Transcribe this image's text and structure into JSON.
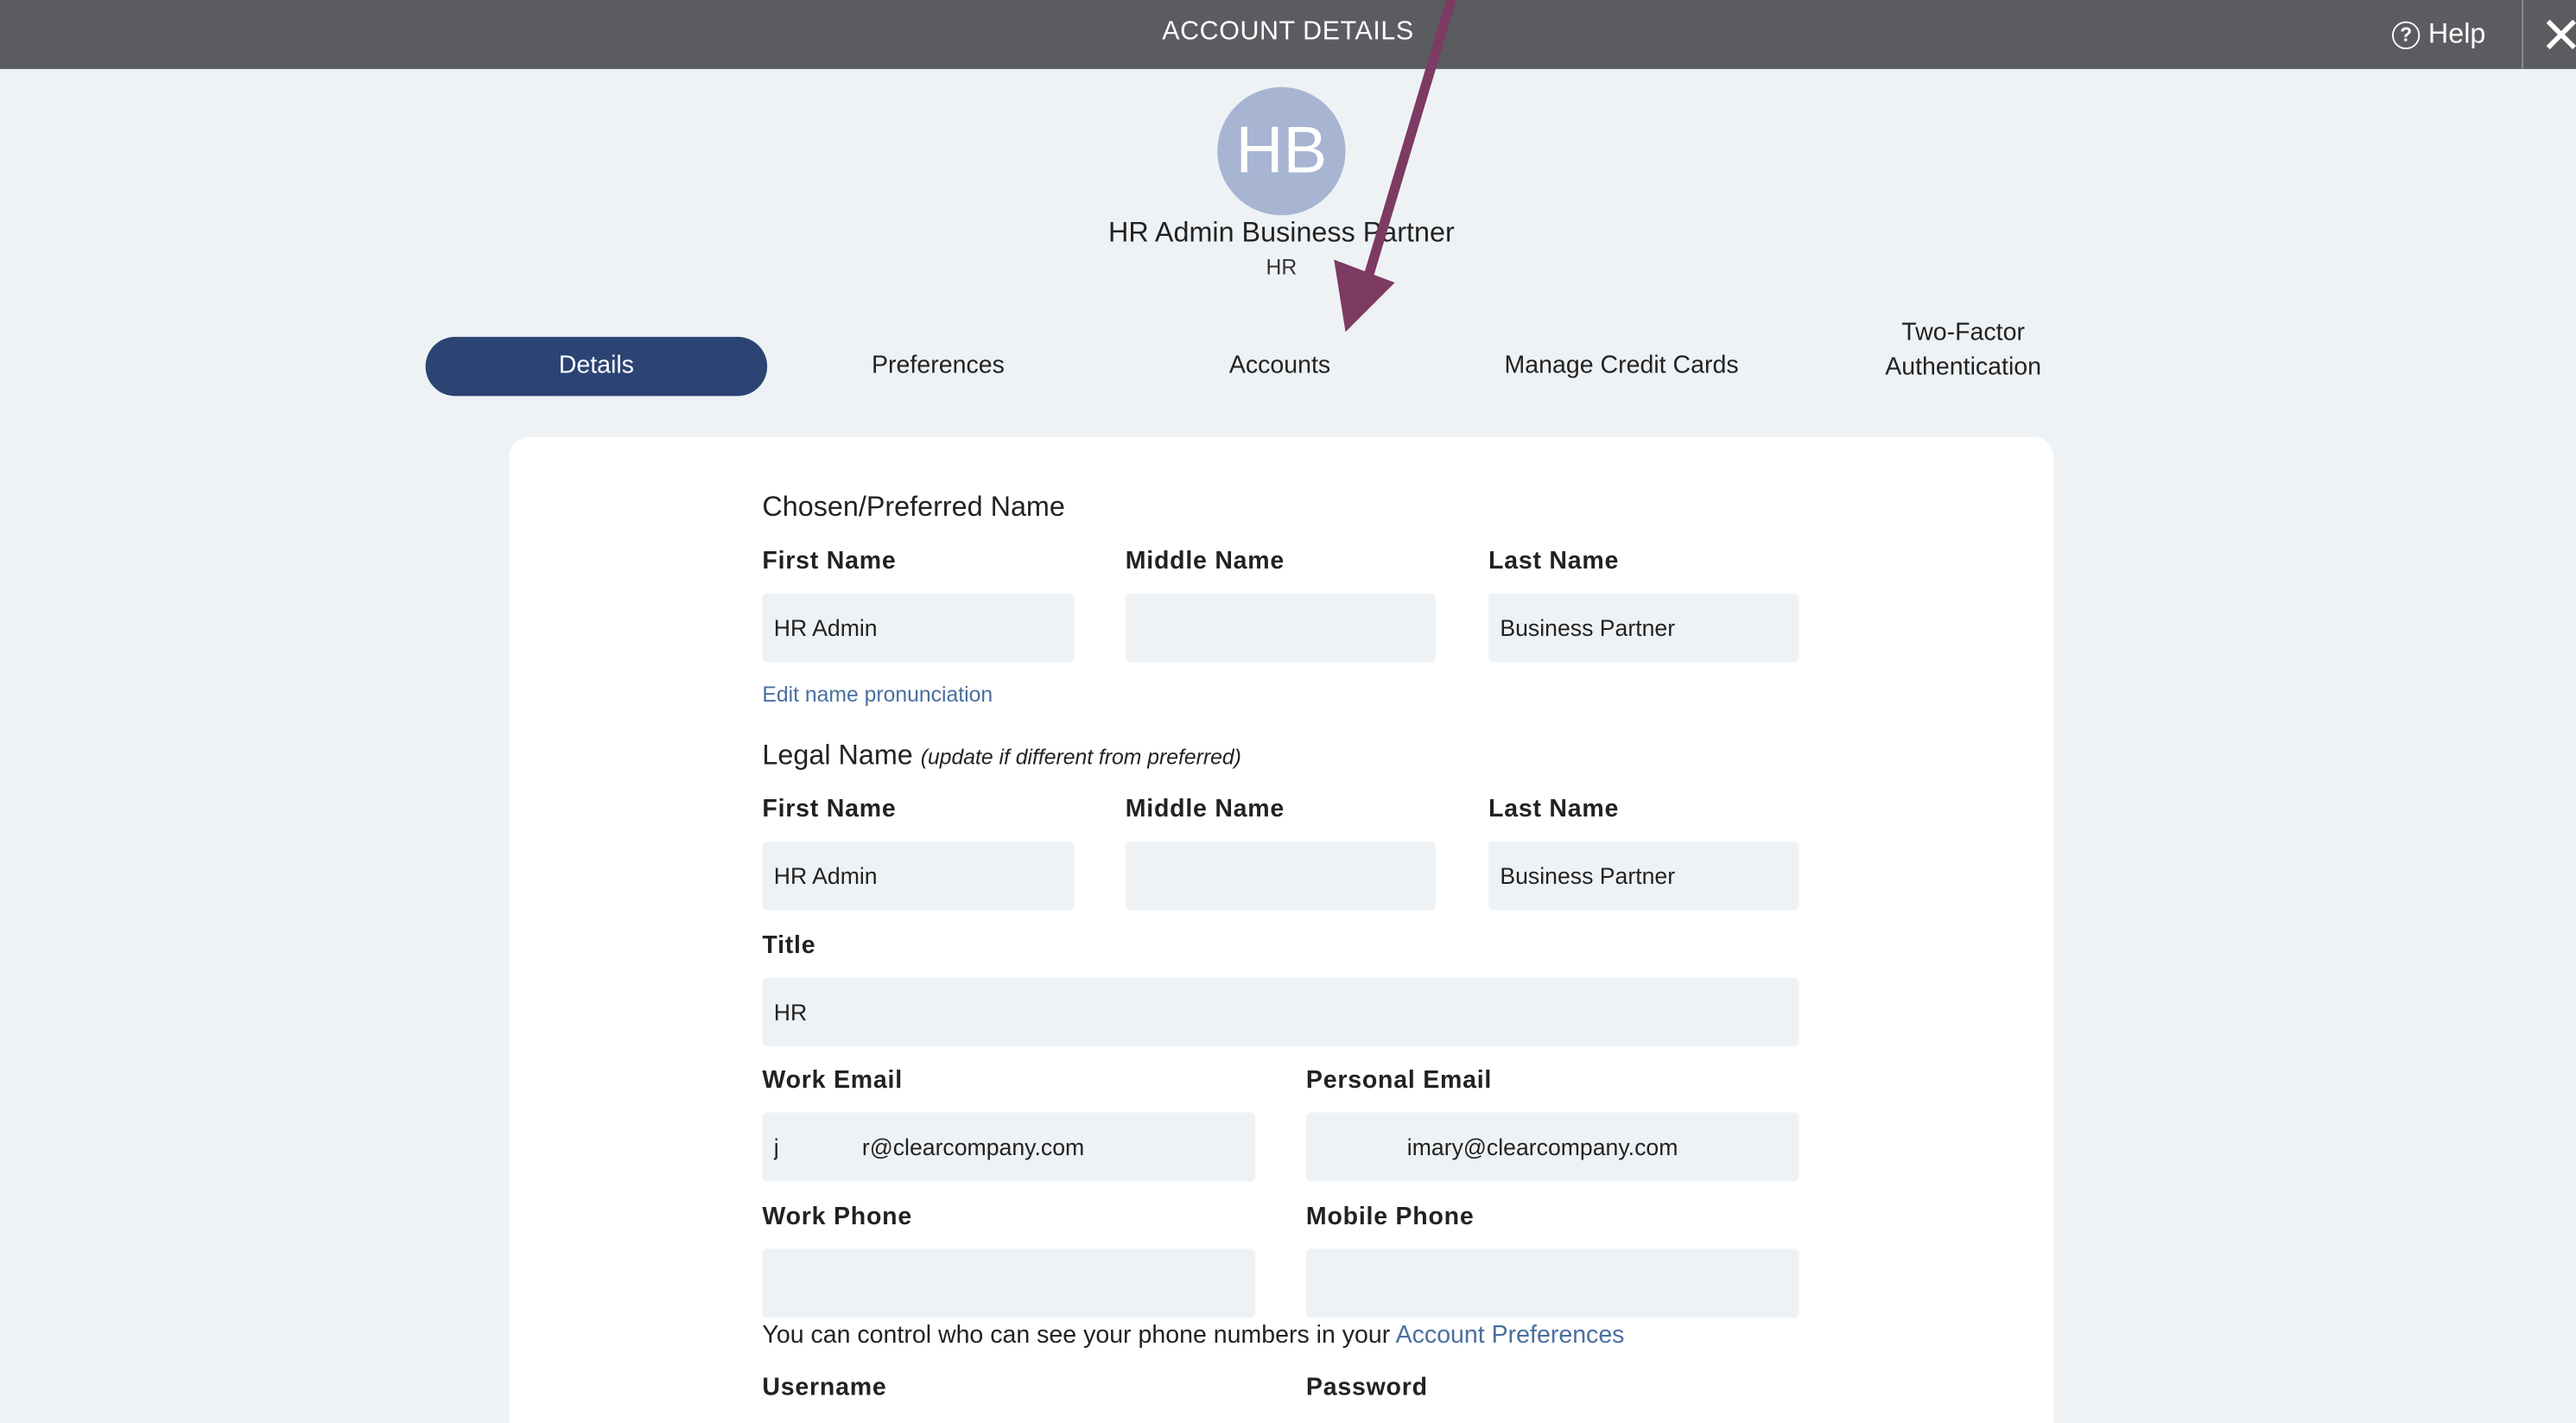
{
  "header": {
    "title": "ACCOUNT DETAILS",
    "help_label": "Help",
    "help_icon": "question-circle-icon",
    "close_icon": "close-icon"
  },
  "profile": {
    "initials": "HB",
    "name": "HR Admin Business Partner",
    "title": "HR",
    "avatar_color": "#a7b5d2"
  },
  "tabs": [
    {
      "label": "Details",
      "active": true
    },
    {
      "label": "Preferences",
      "active": false
    },
    {
      "label": "Accounts",
      "active": false
    },
    {
      "label": "Manage Credit Cards",
      "active": false
    },
    {
      "label_line1": "Two-Factor",
      "label_line2": "Authentication",
      "active": false
    }
  ],
  "form": {
    "preferred_section": "Chosen/Preferred Name",
    "preferred": {
      "first_label": "First Name",
      "first_value": "HR Admin",
      "middle_label": "Middle Name",
      "middle_value": "",
      "last_label": "Last Name",
      "last_value": "Business Partner"
    },
    "pronunciation_link": "Edit name pronunciation",
    "legal_section": "Legal Name",
    "legal_hint": "(update if different from preferred)",
    "legal": {
      "first_label": "First Name",
      "first_value": "HR Admin",
      "middle_label": "Middle Name",
      "middle_value": "",
      "last_label": "Last Name",
      "last_value": "Business Partner"
    },
    "title_label": "Title",
    "title_value": "HR",
    "work_email_label": "Work Email",
    "work_email_value": "j             r@clearcompany.com",
    "personal_email_label": "Personal Email",
    "personal_email_value": "              imary@clearcompany.com",
    "work_phone_label": "Work Phone",
    "work_phone_value": "",
    "mobile_phone_label": "Mobile Phone",
    "mobile_phone_value": "",
    "phone_note": "You can control who can see your phone numbers in your",
    "phone_note_link": "Account Preferences",
    "username_label": "Username",
    "password_label": "Password"
  },
  "colors": {
    "topbar": "#5a5c60",
    "active_tab": "#2b4474",
    "link": "#4a6fa0",
    "annotation_arrow": "#7d3a63",
    "field_bg": "#eff2f5"
  }
}
